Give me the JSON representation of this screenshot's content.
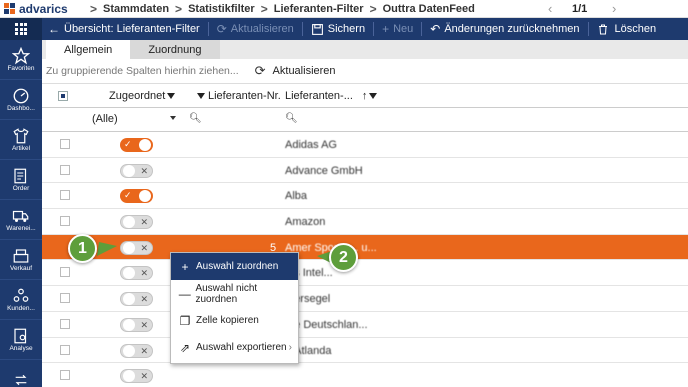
{
  "topbar": {
    "logo_text": "advarics",
    "breadcrumbs": [
      "Stammdaten",
      "Statistikfilter",
      "Lieferanten-Filter",
      "Outtra DatenFeed"
    ],
    "pager": "1/1"
  },
  "sidebar": {
    "items": [
      {
        "label": "Favoriten",
        "icon": "star-icon"
      },
      {
        "label": "Dashbo...",
        "icon": "gauge-icon"
      },
      {
        "label": "Artikel",
        "icon": "shirt-icon"
      },
      {
        "label": "Order",
        "icon": "order-icon"
      },
      {
        "label": "Warenei...",
        "icon": "truck-icon"
      },
      {
        "label": "Verkauf",
        "icon": "register-icon"
      },
      {
        "label": "Kunden...",
        "icon": "customers-icon"
      },
      {
        "label": "Analyse",
        "icon": "analysis-icon"
      }
    ]
  },
  "actionbar": {
    "back_title": "Übersicht: Lieferanten-Filter",
    "refresh": "Aktualisieren",
    "save": "Sichern",
    "new": "Neu",
    "undo": "Änderungen zurücknehmen",
    "delete": "Löschen"
  },
  "tabs": [
    "Allgemein",
    "Zuordnung"
  ],
  "groupbar": {
    "hint": "Zu gruppierende Spalten hierhin ziehen...",
    "refresh": "Aktualisieren"
  },
  "grid": {
    "columns": [
      "Zugeordnet",
      "Lieferanten-Nr.",
      "Lieferanten-..."
    ],
    "filter_value": "(Alle)",
    "rows": [
      {
        "assigned": true,
        "num": "",
        "name": "Adidas AG"
      },
      {
        "assigned": false,
        "num": "",
        "name": "Advance GmbH"
      },
      {
        "assigned": true,
        "num": "",
        "name": "Alba"
      },
      {
        "assigned": false,
        "num": "",
        "name": "Amazon"
      },
      {
        "assigned": false,
        "num": "5",
        "name": "Amer Sports ... u...",
        "highlighted": true
      },
      {
        "assigned": false,
        "num": "",
        "name": "...s Intel..."
      },
      {
        "assigned": false,
        "num": "",
        "name": "...ersegel"
      },
      {
        "assigned": false,
        "num": "",
        "name": "...e Deutschlan..."
      },
      {
        "assigned": false,
        "num": "",
        "name": "...Atlanda"
      },
      {
        "assigned": false,
        "num": "",
        "name": ""
      }
    ]
  },
  "context_menu": {
    "items": [
      {
        "label": "Auswahl zuordnen",
        "icon": "plus-icon",
        "active": true
      },
      {
        "label": "Auswahl nicht zuordnen",
        "icon": "minus-icon"
      },
      {
        "label": "Zelle kopieren",
        "icon": "copy-icon"
      },
      {
        "label": "Auswahl exportieren",
        "icon": "export-icon",
        "submenu": true
      }
    ]
  },
  "callouts": [
    "1",
    "2"
  ],
  "colors": {
    "brand_navy": "#1e3a6e",
    "accent_orange": "#e9671c",
    "callout_green": "#5e9e3b"
  }
}
